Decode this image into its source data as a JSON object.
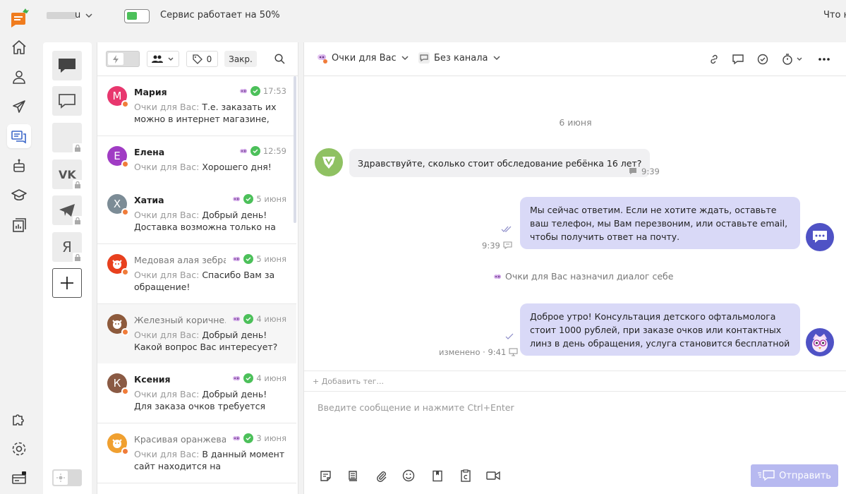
{
  "topbar": {
    "account_suffix": "u",
    "service_status": "Сервис работает на 50%",
    "battery_level": 0.5,
    "whats_new": "Что н"
  },
  "nav": {
    "icons": [
      "home-icon",
      "users-icon",
      "rocket-icon",
      "chats-icon",
      "bot-icon",
      "graduation-icon",
      "reports-icon",
      "puzzle-icon",
      "settings-icon",
      "billing-icon"
    ],
    "active": "chats-icon"
  },
  "channels": {
    "items": [
      "all-chats",
      "chats",
      "empty-channel",
      "vk",
      "telegram",
      "yandex"
    ],
    "lock_icons": [
      "lock-icon"
    ]
  },
  "list_toolbar": {
    "tag_count": "0",
    "closed_label": "Закр."
  },
  "conversations": [
    {
      "initial": "М",
      "color": "#e8376e",
      "name": "Мария",
      "time": "17:53",
      "who": "Очки для Вас:",
      "text": "Т.е. заказать их можно в интернет магазине,",
      "bold": true
    },
    {
      "initial": "Е",
      "color": "#a03cc4",
      "name": "Елена",
      "time": "12:59",
      "who": "Очки для Вас:",
      "text": "Хорошего дня!",
      "bold": true
    },
    {
      "initial": "Х",
      "color": "#7c8c96",
      "name": "Хатиа",
      "time": "5 июня",
      "who": "Очки для Вас:",
      "text": "Добрый день! Доставка возможна только на",
      "bold": true
    },
    {
      "initial": "",
      "color": "#e8401e",
      "name": "Медовая алая зебра",
      "time": "5 июня",
      "who": "Очки для Вас:",
      "text": "Спасибо Вам за обращение!",
      "bold": false
    },
    {
      "initial": "",
      "color": "#8d5a3c",
      "name": "Железный коричне...",
      "time": "4 июня",
      "who": "Очки для Вас:",
      "text": "Добрый день! Какой вопрос Вас интересует?",
      "bold": false
    },
    {
      "initial": "К",
      "color": "#8a5a44",
      "name": "Ксения",
      "time": "4 июня",
      "who": "Очки для Вас:",
      "text": "Добрый день! Для заказа очков требуется",
      "bold": true
    },
    {
      "initial": "",
      "color": "#f0a030",
      "name": "Красивая оранжева...",
      "time": "3 июня",
      "who": "Очки для Вас:",
      "text": "В данный момент сайт находится на реконструкции,",
      "bold": false
    }
  ],
  "chat": {
    "assignee": "Очки для Вас",
    "channel": "Без канала",
    "date_separator": "6 июня",
    "incoming": {
      "text": "Здравствуйте, сколько стоит обследование ребёнка 16 лет?",
      "time": "9:39"
    },
    "outgoing1": {
      "text": "Мы сейчас ответим. Если не хотите ждать, оставьте ваш телефон, мы Вам перезвоним, или оставьте email, чтобы получить ответ на почту.",
      "time": "9:39"
    },
    "system": "Очки для Вас назначил диалог себе",
    "outgoing2": {
      "text": "Доброе утро! Консультация детского офтальмолога стоит 1000 рублей, при заказе очков или контактных линз в день обращения, услуга становится бесплатной",
      "meta": "изменено · 9:41"
    },
    "add_tag": "+ Добавить тег...",
    "composer_placeholder": "Введите сообщение и нажмите Ctrl+Enter",
    "send_label": "Отправить"
  }
}
